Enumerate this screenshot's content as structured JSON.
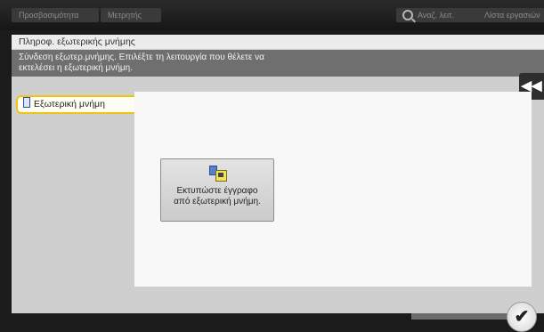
{
  "topbar": {
    "accessibility_label": "Προσβασιμότητα",
    "counter_label": "Μετρητής",
    "search_label": "Αναζ. λειτ.",
    "job_list_label": "Λίστα εργασιών"
  },
  "panel": {
    "title": "Πληροφ. εξωτερικής μνήμης",
    "message_line1": "Σύνδεση εξωτερ.μνήμης. Επιλέξτε τη λειτουργία που θέλετε να",
    "message_line2": "εκτελέσει η εξωτερική μνήμη.",
    "back_icon": "double-left-arrow",
    "back_glyph": "◀◀"
  },
  "tabs": [
    {
      "label": "Εξωτερική μνήμη",
      "selected": true,
      "icon": "memory-icon"
    }
  ],
  "function_button": {
    "icon": "print-from-memory-icon",
    "label_line1": "Εκτυπώστε έγγραφο",
    "label_line2": "από εξωτερική μνήμη."
  },
  "footer": {
    "progress_text": "",
    "ok_glyph": "✔"
  },
  "colors": {
    "selected_tab_border": "#f1c40f",
    "message_bg": "#6f6f6f",
    "panel_bg": "#cfcfcf"
  }
}
